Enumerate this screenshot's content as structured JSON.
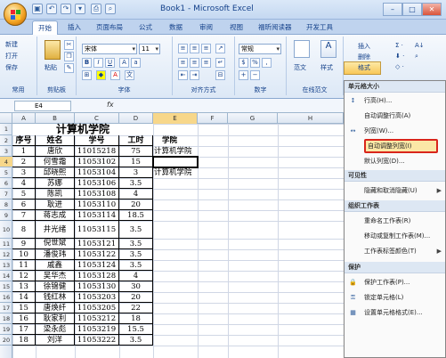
{
  "window": {
    "title": "Book1 - Microsoft Excel"
  },
  "tabs": [
    "开始",
    "插入",
    "页面布局",
    "公式",
    "数据",
    "审阅",
    "视图",
    "福昕阅读器",
    "开发工具"
  ],
  "ribbon": {
    "clipboard": {
      "new": "新建",
      "open": "打开",
      "save": "保存",
      "paste": "粘贴",
      "group": "剪贴板",
      "common": "常用"
    },
    "font": {
      "name": "宋体",
      "size": "11",
      "group": "字体"
    },
    "alignment": {
      "group": "对齐方式"
    },
    "number": {
      "format": "常规",
      "group": "数字"
    },
    "style": {
      "fanwen": "范文",
      "style": "样式",
      "group": "在线范文"
    },
    "cells": {
      "insert": "插入",
      "delete": "删除",
      "format": "格式"
    }
  },
  "formula_bar": {
    "name_box": "E4",
    "fx": "fx"
  },
  "columns": [
    "A",
    "B",
    "C",
    "D",
    "E",
    "F",
    "G",
    "H"
  ],
  "rows": [
    "1",
    "2",
    "3",
    "4",
    "5",
    "6",
    "7",
    "8",
    "9",
    "10",
    "11",
    "12",
    "13",
    "14",
    "15",
    "16",
    "17",
    "18",
    "19",
    "20"
  ],
  "sheet": {
    "title": "计算机学院",
    "headers": [
      "序号",
      "姓名",
      "学号",
      "工时"
    ],
    "rows": [
      [
        "1",
        "唐欣",
        "11015218",
        "75"
      ],
      [
        "2",
        "何雪霜",
        "11053102",
        "15"
      ],
      [
        "3",
        "邱晓熙",
        "11053104",
        "3"
      ],
      [
        "4",
        "苏娜",
        "11053106",
        "3.5"
      ],
      [
        "5",
        "陈凯",
        "11053108",
        "4"
      ],
      [
        "6",
        "耿进",
        "11053110",
        "20"
      ],
      [
        "7",
        "蒋志成",
        "11053114",
        "18.5"
      ],
      [
        "8",
        "井光绪",
        "11053115",
        "3.5"
      ],
      [
        "9",
        "倪世斌",
        "11053121",
        "3.5"
      ],
      [
        "10",
        "潘俊玮",
        "11053122",
        "3.5"
      ],
      [
        "11",
        "戚鑫",
        "11053124",
        "3.5"
      ],
      [
        "12",
        "吴华杰",
        "11053128",
        "4"
      ],
      [
        "13",
        "徐锦健",
        "11053130",
        "30"
      ],
      [
        "14",
        "钱红林",
        "11053203",
        "20"
      ],
      [
        "15",
        "唐焕纤",
        "11053205",
        "22"
      ],
      [
        "16",
        "耿家利",
        "11053212",
        "18"
      ],
      [
        "17",
        "梁永彪",
        "11053219",
        "15.5"
      ],
      [
        "18",
        "刘洋",
        "11053222",
        "3.5"
      ]
    ],
    "e_header": "学院",
    "e_values": [
      "计算机学院",
      "",
      "计算机学院"
    ]
  },
  "menu": {
    "sections": {
      "size": "单元格大小",
      "visibility": "可见性",
      "organize": "组织工作表",
      "protect": "保护"
    },
    "items": {
      "row_height": "行高(H)...",
      "autofit_row": "自动调整行高(A)",
      "col_width": "列宽(W)...",
      "autofit_col": "自动调整列宽(I)",
      "default_width": "默认列宽(D)...",
      "hide_unhide": "隐藏和取消隐藏(U)",
      "rename": "重命名工作表(R)",
      "move_copy": "移动或复制工作表(M)...",
      "tab_color": "工作表标签颜色(T)",
      "protect_sheet": "保护工作表(P)...",
      "lock_cell": "锁定单元格(L)",
      "format_cells": "设置单元格格式(E)..."
    }
  }
}
